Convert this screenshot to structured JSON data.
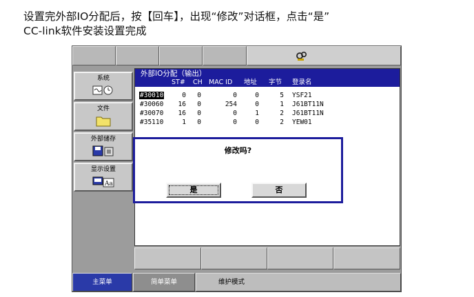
{
  "caption": {
    "line1": "设置完外部IO分配后，按【回车】，出现“修改”对话框，点击“是”",
    "line2": "CC-link软件安装设置完成"
  },
  "status_bar": {
    "icon": "hand-gears-icon"
  },
  "sidebar": {
    "items": [
      {
        "label": "系统",
        "icon": "system-icon"
      },
      {
        "label": "文件",
        "icon": "folder-icon"
      },
      {
        "label": "外部储存",
        "icon": "external-storage-icon"
      },
      {
        "label": "显示设置",
        "icon": "display-settings-icon"
      }
    ]
  },
  "window": {
    "title": "外部IO分配（输出）",
    "columns": [
      "ST#",
      "CH",
      "MAC ID",
      "地址",
      "字节",
      "登录名"
    ],
    "rows": [
      {
        "id": "#30010",
        "st": "0",
        "ch": "0",
        "mac": "0",
        "addr": "0",
        "bytes": "5",
        "name": "YSF21",
        "selected": true
      },
      {
        "id": "#30060",
        "st": "16",
        "ch": "0",
        "mac": "254",
        "addr": "0",
        "bytes": "1",
        "name": "J61BT11N"
      },
      {
        "id": "#30070",
        "st": "16",
        "ch": "0",
        "mac": "0",
        "addr": "1",
        "bytes": "2",
        "name": "J61BT11N"
      },
      {
        "id": "#35110",
        "st": "1",
        "ch": "0",
        "mac": "0",
        "addr": "0",
        "bytes": "2",
        "name": "YEW01"
      }
    ]
  },
  "dialog": {
    "message": "修改吗?",
    "yes_label": "是",
    "no_label": "否"
  },
  "bottom_bar": {
    "main_menu": "主菜单",
    "simple_menu": "简单菜单",
    "mode": "维护模式"
  },
  "colors": {
    "title_blue": "#1c1c9c",
    "menu_blue": "#2a3aa8",
    "panel_gray": "#9c9c9c"
  }
}
